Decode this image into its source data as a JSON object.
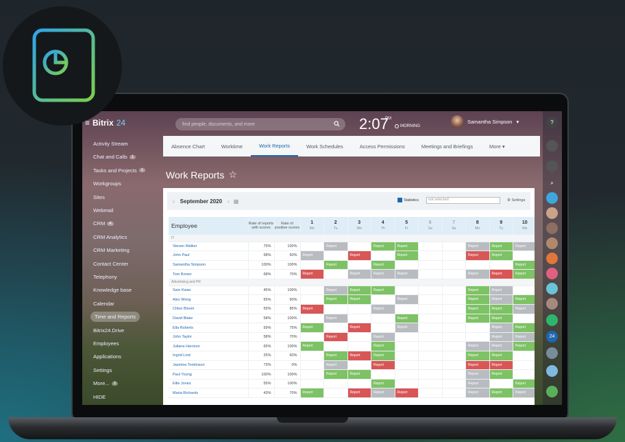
{
  "brand": {
    "name": "Bitrix",
    "suffix": "24"
  },
  "left_menu": [
    {
      "label": "Activity Stream",
      "count": ""
    },
    {
      "label": "Chat and Calls",
      "count": "1"
    },
    {
      "label": "Tasks and Projects",
      "count": "1"
    },
    {
      "label": "Workgroups",
      "count": ""
    },
    {
      "label": "Sites",
      "count": ""
    },
    {
      "label": "Webmail",
      "count": ""
    },
    {
      "label": "CRM",
      "count": "4"
    },
    {
      "label": "CRM Analytics",
      "count": ""
    },
    {
      "label": "CRM Marketing",
      "count": ""
    },
    {
      "label": "Contact Center",
      "count": ""
    },
    {
      "label": "Telephony",
      "count": ""
    },
    {
      "label": "Knowledge base",
      "count": ""
    },
    {
      "label": "Calendar",
      "count": ""
    },
    {
      "label": "Time and Reports",
      "count": ""
    },
    {
      "label": "Bitrix24.Drive",
      "count": ""
    },
    {
      "label": "Employees",
      "count": ""
    },
    {
      "label": "Applications",
      "count": ""
    },
    {
      "label": "Settings",
      "count": ""
    },
    {
      "label": "More...",
      "count": "3"
    },
    {
      "label": "HIDE",
      "count": ""
    }
  ],
  "header": {
    "search_placeholder": "find people, documents, and more",
    "clock": "2:07",
    "clock_suffix": "PM",
    "clock_status": "MORNING",
    "user_name": "Samantha Simpson"
  },
  "tabs": [
    {
      "label": "Absence Chart"
    },
    {
      "label": "Worktime"
    },
    {
      "label": "Work Reports"
    },
    {
      "label": "Work Schedules"
    },
    {
      "label": "Access Permissions"
    },
    {
      "label": "Meetings and Briefings"
    },
    {
      "label": "More ▾"
    }
  ],
  "page_title": "Work Reports",
  "filter": {
    "month": "September 2020",
    "statistics_label": "Statistics",
    "select_placeholder": "not selected",
    "settings_label": "Settings"
  },
  "table": {
    "col_employee": "Employee",
    "col_rate_scores": "Rate of reports with scores",
    "col_rate_positive": "Rate of positive scores",
    "days": [
      {
        "num": "1",
        "dow": "Mo"
      },
      {
        "num": "2",
        "dow": "Tu"
      },
      {
        "num": "3",
        "dow": "We"
      },
      {
        "num": "4",
        "dow": "Th"
      },
      {
        "num": "5",
        "dow": "Fr"
      },
      {
        "num": "6",
        "dow": "Sa"
      },
      {
        "num": "7",
        "dow": "Su"
      },
      {
        "num": "8",
        "dow": "Mo"
      },
      {
        "num": "9",
        "dow": "Tu"
      },
      {
        "num": "10",
        "dow": "We"
      }
    ],
    "cell_label": "Report",
    "groups": [
      {
        "name": "IT",
        "rows": [
          {
            "name": "Steven Walker",
            "r1": "75%",
            "r2": "100%",
            "cells": [
              "",
              "s",
              "",
              "g",
              "g",
              "",
              "",
              "s",
              "g",
              "s"
            ]
          },
          {
            "name": "John Paul",
            "r1": "58%",
            "r2": "60%",
            "cells": [
              "s",
              "",
              "r",
              "",
              "g",
              "",
              "",
              "r",
              "g",
              ""
            ]
          },
          {
            "name": "Samantha Simpson",
            "r1": "100%",
            "r2": "100%",
            "cells": [
              "",
              "g",
              "",
              "g",
              "",
              "",
              "",
              "",
              "",
              "g"
            ]
          },
          {
            "name": "Tom Brown",
            "r1": "68%",
            "r2": "70%",
            "cells": [
              "r",
              "",
              "s",
              "s",
              "s",
              "",
              "",
              "s",
              "r",
              "g"
            ]
          }
        ]
      },
      {
        "name": "Advertising and PR",
        "rows": [
          {
            "name": "Sam Kwan",
            "r1": "45%",
            "r2": "100%",
            "cells": [
              "",
              "s",
              "g",
              "g",
              "",
              "",
              "",
              "g",
              "s",
              ""
            ]
          },
          {
            "name": "Alex Wong",
            "r1": "65%",
            "r2": "90%",
            "cells": [
              "",
              "g",
              "g",
              "",
              "s",
              "",
              "",
              "g",
              "s",
              "g"
            ]
          },
          {
            "name": "Chloe Bloom",
            "r1": "55%",
            "r2": "85%",
            "cells": [
              "r",
              "",
              "",
              "s",
              "",
              "",
              "",
              "g",
              "g",
              "s"
            ]
          },
          {
            "name": "David Blake",
            "r1": "58%",
            "r2": "100%",
            "cells": [
              "",
              "s",
              "",
              "",
              "g",
              "",
              "",
              "g",
              "g",
              ""
            ]
          },
          {
            "name": "Ella Roberts",
            "r1": "59%",
            "r2": "75%",
            "cells": [
              "g",
              "",
              "r",
              "",
              "s",
              "",
              "",
              "",
              "s",
              "g"
            ]
          },
          {
            "name": "John Taylor",
            "r1": "58%",
            "r2": "70%",
            "cells": [
              "",
              "r",
              "",
              "s",
              "",
              "",
              "",
              "",
              "s",
              "s"
            ]
          },
          {
            "name": "Juliana Harrison",
            "r1": "65%",
            "r2": "100%",
            "cells": [
              "g",
              "",
              "",
              "g",
              "",
              "",
              "",
              "s",
              "s",
              "g"
            ]
          },
          {
            "name": "Ingrid Lind",
            "r1": "25%",
            "r2": "60%",
            "cells": [
              "",
              "g",
              "r",
              "g",
              "",
              "",
              "",
              "g",
              "g",
              ""
            ]
          },
          {
            "name": "Jasmine Tomlinson",
            "r1": "73%",
            "r2": "0%",
            "cells": [
              "",
              "s",
              "",
              "r",
              "",
              "",
              "",
              "r",
              "r",
              ""
            ]
          },
          {
            "name": "Paul Young",
            "r1": "100%",
            "r2": "100%",
            "cells": [
              "",
              "g",
              "g",
              "",
              "",
              "",
              "",
              "s",
              "g",
              ""
            ]
          },
          {
            "name": "Ellie Jones",
            "r1": "55%",
            "r2": "100%",
            "cells": [
              "",
              "",
              "",
              "g",
              "",
              "",
              "",
              "s",
              "",
              "g"
            ]
          },
          {
            "name": "Maria Richards",
            "r1": "43%",
            "r2": "70%",
            "cells": [
              "g",
              "",
              "r",
              "s",
              "r",
              "",
              "",
              "s",
              "g",
              "s"
            ]
          }
        ]
      }
    ]
  },
  "colors": {
    "green": "#7dc264",
    "red": "#d95656",
    "grey": "#b8bcc0",
    "accent": "#2067b0"
  }
}
